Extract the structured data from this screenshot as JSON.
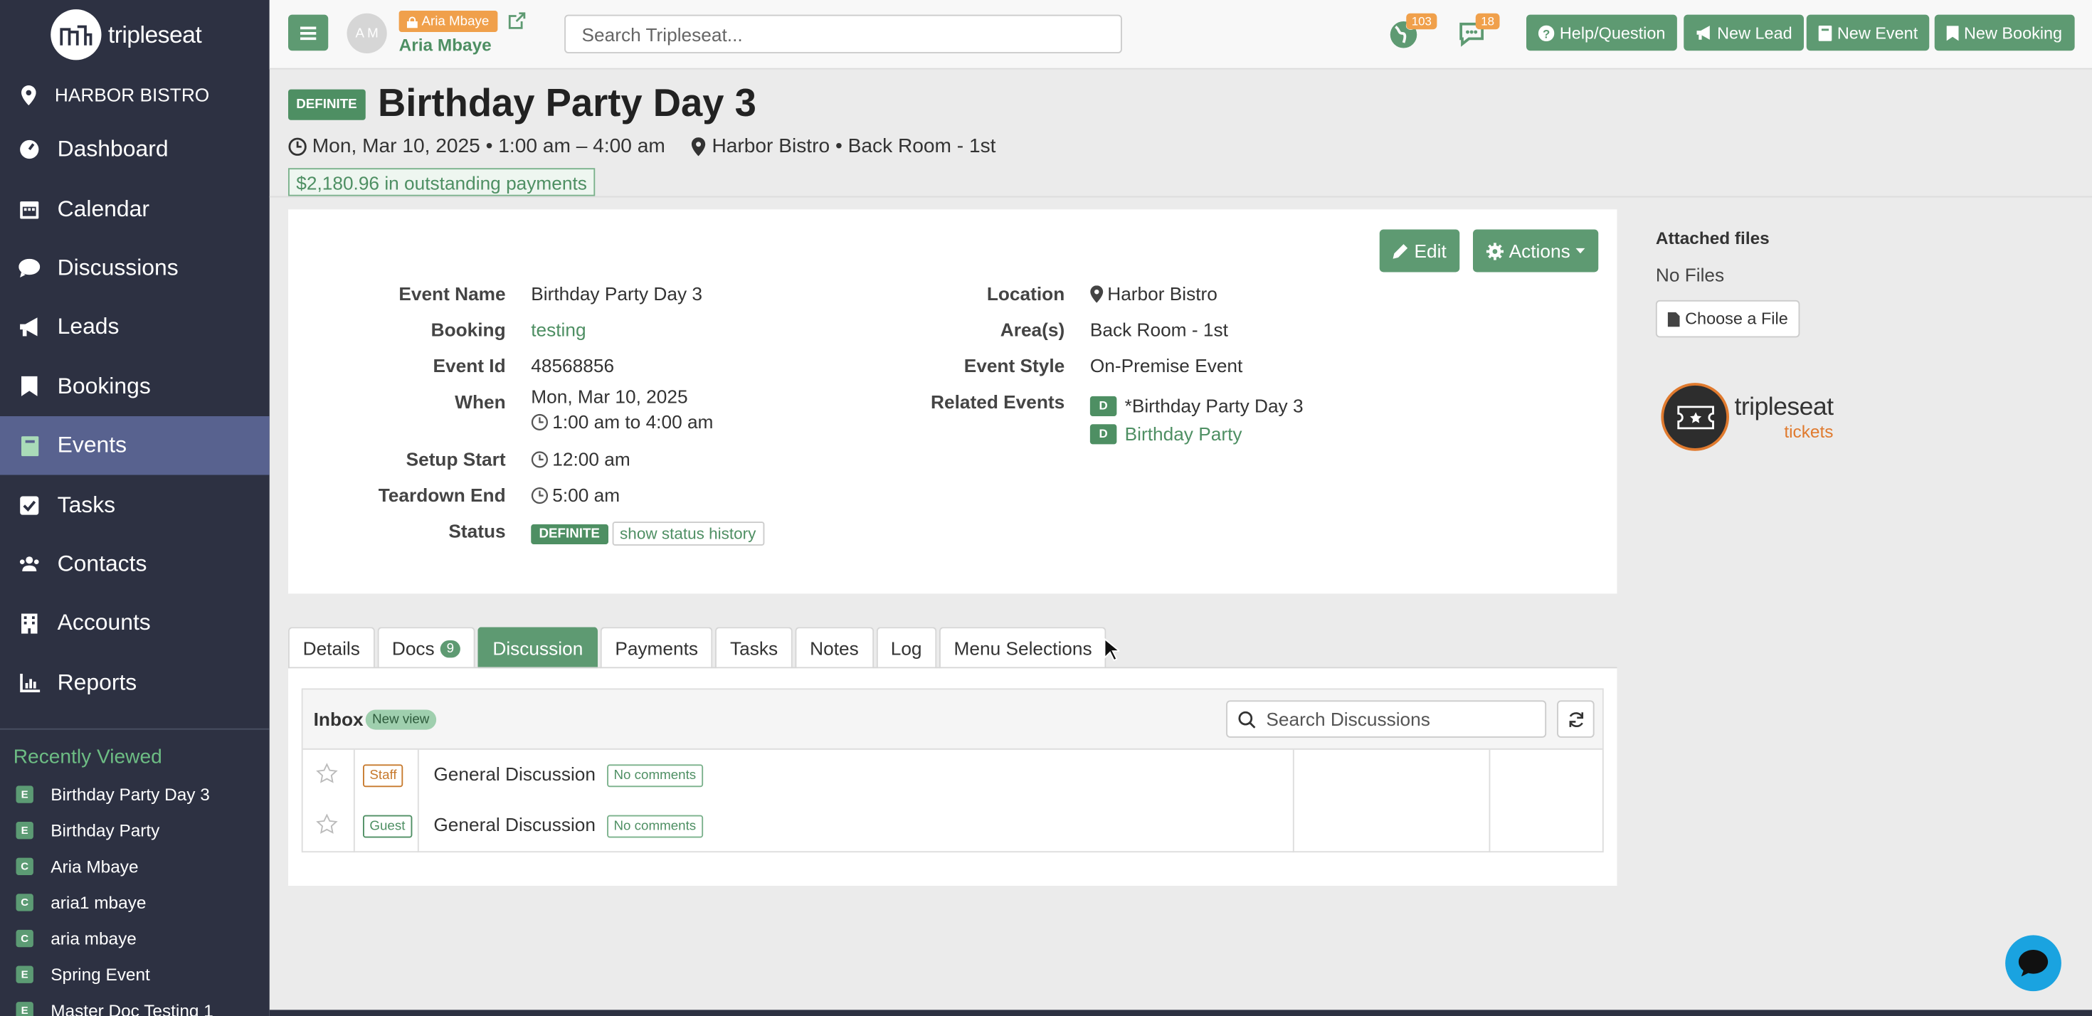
{
  "brand": {
    "logo_text": "tripleseat"
  },
  "sidebar": {
    "venue": "HARBOR BISTRO",
    "items": [
      {
        "label": "Dashboard",
        "icon": "dashboard-icon"
      },
      {
        "label": "Calendar",
        "icon": "calendar-icon"
      },
      {
        "label": "Discussions",
        "icon": "chat-icon"
      },
      {
        "label": "Leads",
        "icon": "megaphone-icon"
      },
      {
        "label": "Bookings",
        "icon": "bookmark-icon"
      },
      {
        "label": "Events",
        "icon": "book-icon",
        "active": true
      },
      {
        "label": "Tasks",
        "icon": "checkbox-icon"
      },
      {
        "label": "Contacts",
        "icon": "users-icon"
      },
      {
        "label": "Accounts",
        "icon": "building-icon"
      },
      {
        "label": "Reports",
        "icon": "bar-chart-icon"
      }
    ],
    "recent_title": "Recently Viewed",
    "recent": [
      {
        "badge": "E",
        "label": "Birthday Party Day 3"
      },
      {
        "badge": "E",
        "label": "Birthday Party"
      },
      {
        "badge": "C",
        "label": "Aria Mbaye"
      },
      {
        "badge": "C",
        "label": "aria1 mbaye"
      },
      {
        "badge": "C",
        "label": "aria mbaye"
      },
      {
        "badge": "E",
        "label": "Spring Event"
      },
      {
        "badge": "E",
        "label": "Master Doc Testing 1"
      }
    ]
  },
  "topbar": {
    "avatar_initials": "A M",
    "owner_badge": "Aria Mbaye",
    "owner_name": "Aria Mbaye",
    "search_placeholder": "Search Tripleseat...",
    "notif_globe_count": "103",
    "notif_chat_count": "18",
    "buttons": {
      "help": "Help/Question",
      "new_lead": "New Lead",
      "new_event": "New Event",
      "new_booking": "New Booking"
    }
  },
  "event": {
    "status": "DEFINITE",
    "title": "Birthday Party Day 3",
    "datetime": "Mon, Mar 10, 2025 • 1:00 am – 4:00 am",
    "location_line": "Harbor Bistro • Back Room - 1st",
    "outstanding": "$2,180.96 in outstanding payments"
  },
  "panel": {
    "edit_label": "Edit",
    "actions_label": "Actions",
    "labels": {
      "event_name": "Event Name",
      "booking": "Booking",
      "event_id": "Event Id",
      "when": "When",
      "setup_start": "Setup Start",
      "teardown_end": "Teardown End",
      "status": "Status",
      "location": "Location",
      "areas": "Area(s)",
      "event_style": "Event Style",
      "related_events": "Related Events"
    },
    "values": {
      "event_name": "Birthday Party Day 3",
      "booking": "testing",
      "event_id": "48568856",
      "when_date": "Mon, Mar 10, 2025",
      "when_time": "1:00 am to 4:00 am",
      "setup_start": "12:00 am",
      "teardown_end": "5:00 am",
      "status": "DEFINITE",
      "status_history": "show status history",
      "location": "Harbor Bistro",
      "areas": "Back Room - 1st",
      "event_style": "On-Premise Event",
      "related": [
        {
          "badge": "D",
          "label": "*Birthday Party Day 3"
        },
        {
          "badge": "D",
          "label": "Birthday Party"
        }
      ]
    }
  },
  "files": {
    "title": "Attached files",
    "empty": "No Files",
    "choose": "Choose a File"
  },
  "tickets_logo": {
    "line1": "tripleseat",
    "line2": "tickets"
  },
  "tabs": [
    {
      "label": "Details"
    },
    {
      "label": "Docs",
      "count": "9"
    },
    {
      "label": "Discussion",
      "active": true
    },
    {
      "label": "Payments"
    },
    {
      "label": "Tasks"
    },
    {
      "label": "Notes"
    },
    {
      "label": "Log"
    },
    {
      "label": "Menu Selections"
    }
  ],
  "discussion": {
    "inbox": "Inbox",
    "new_view": "New view",
    "search_placeholder": "Search Discussions",
    "rows": [
      {
        "role": "Staff",
        "title": "General Discussion",
        "comments": "No comments"
      },
      {
        "role": "Guest",
        "title": "General Discussion",
        "comments": "No comments"
      }
    ]
  },
  "colors": {
    "brand_green": "#5e9a72",
    "sidebar_bg": "#2d3142",
    "active_nav": "#58628f",
    "accent_orange": "#f0a04b"
  }
}
